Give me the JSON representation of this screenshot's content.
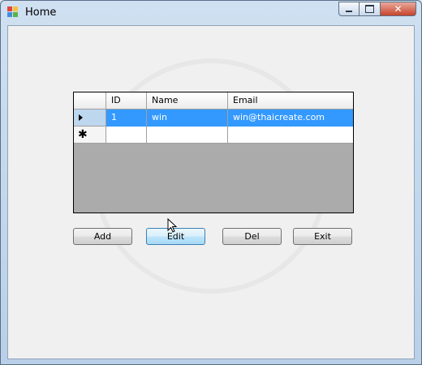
{
  "window": {
    "title": "Home"
  },
  "grid": {
    "columns": [
      "ID",
      "Name",
      "Email"
    ],
    "rows": [
      {
        "id": "1",
        "name": "win",
        "email": "win@thaicreate.com"
      }
    ]
  },
  "buttons": {
    "add": "Add",
    "edit": "Edit",
    "del": "Del",
    "exit": "Exit"
  }
}
